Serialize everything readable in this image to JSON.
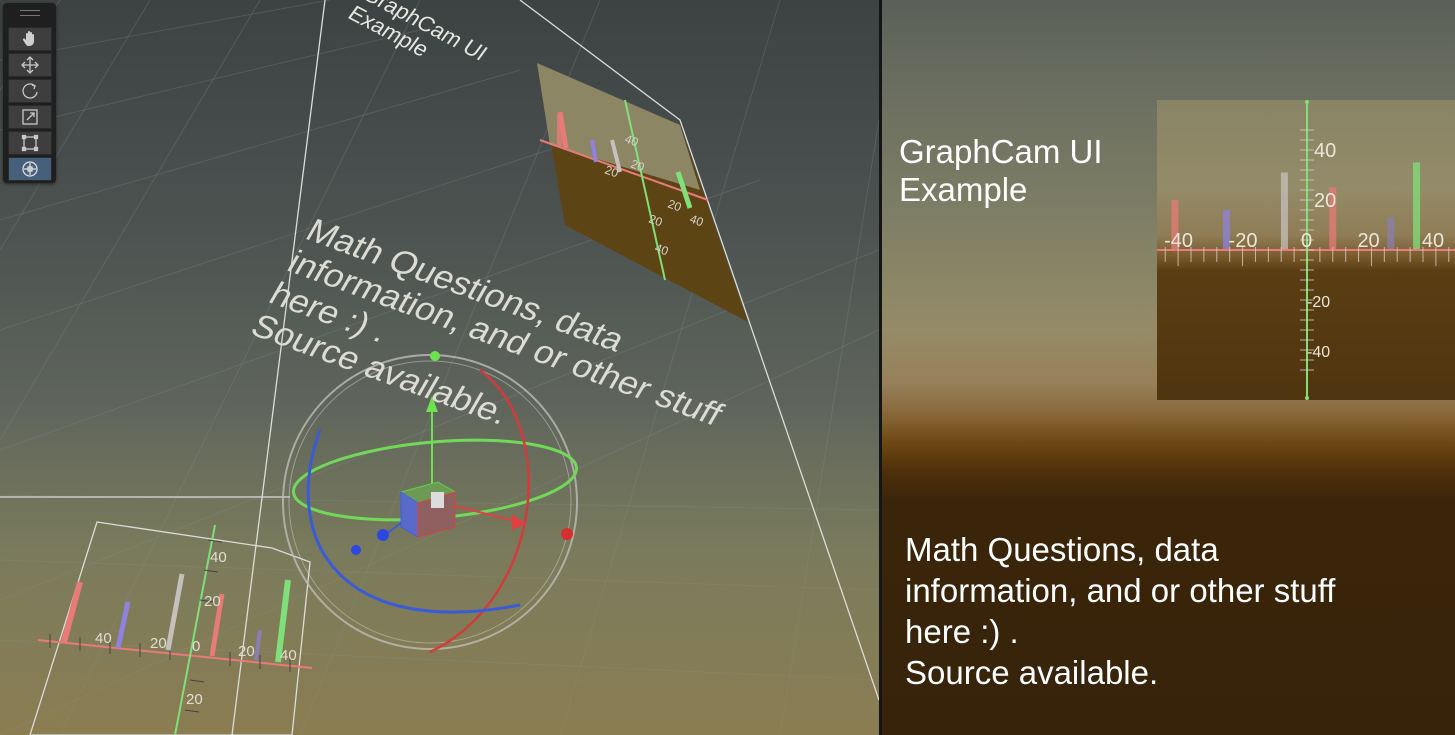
{
  "scene_view": {
    "tool_palette": {
      "tools": [
        {
          "name": "hand-tool",
          "icon": "hand-icon",
          "active": false
        },
        {
          "name": "move-tool",
          "icon": "move-arrows-icon",
          "active": false
        },
        {
          "name": "rotate-tool",
          "icon": "rotate-icon",
          "active": false
        },
        {
          "name": "scale-tool",
          "icon": "scale-icon",
          "active": false
        },
        {
          "name": "rect-tool",
          "icon": "rect-transform-icon",
          "active": false
        },
        {
          "name": "transform-tool",
          "icon": "transform-icon",
          "active": true
        }
      ],
      "active_color": "#46607c"
    },
    "world_title": "GraphCam UI\nExample",
    "world_body": "Math Questions, data\ninformation, and or other stuff\nhere :) .\nSource available.",
    "world_graph_labels": {
      "x_ticks": [
        "40",
        "20",
        "0",
        "20",
        "40"
      ],
      "y_ticks": [
        "40",
        "20",
        "20"
      ]
    },
    "top_graph_labels": [
      "40",
      "20",
      "20",
      "20",
      "40",
      "20",
      "40"
    ]
  },
  "game_view": {
    "title": "GraphCam UI\nExample",
    "body": "Math Questions, data\ninformation, and or other stuff\nhere :) .\nSource available."
  },
  "chart_data": {
    "type": "bar",
    "x_ticks": [
      "-40",
      "-20",
      "0",
      "20",
      "40"
    ],
    "y_ticks": [
      "40",
      "20",
      "-20",
      "-40"
    ],
    "xlim": [
      -45,
      45
    ],
    "ylim": [
      -50,
      50
    ],
    "axis_colors": {
      "x": "#e87a78",
      "y": "#7fe07a"
    },
    "bars": [
      {
        "x": -41,
        "height": 20,
        "color": "#e87a78"
      },
      {
        "x": -25,
        "height": 16,
        "color": "#8f82e0"
      },
      {
        "x": -7,
        "height": 31,
        "color": "#c4c0bc"
      },
      {
        "x": 8,
        "height": 25,
        "color": "#e87a78"
      },
      {
        "x": 26,
        "height": 13,
        "color": "#8a7fb0"
      },
      {
        "x": 34,
        "height": 35,
        "color": "#7fe07a"
      }
    ]
  }
}
